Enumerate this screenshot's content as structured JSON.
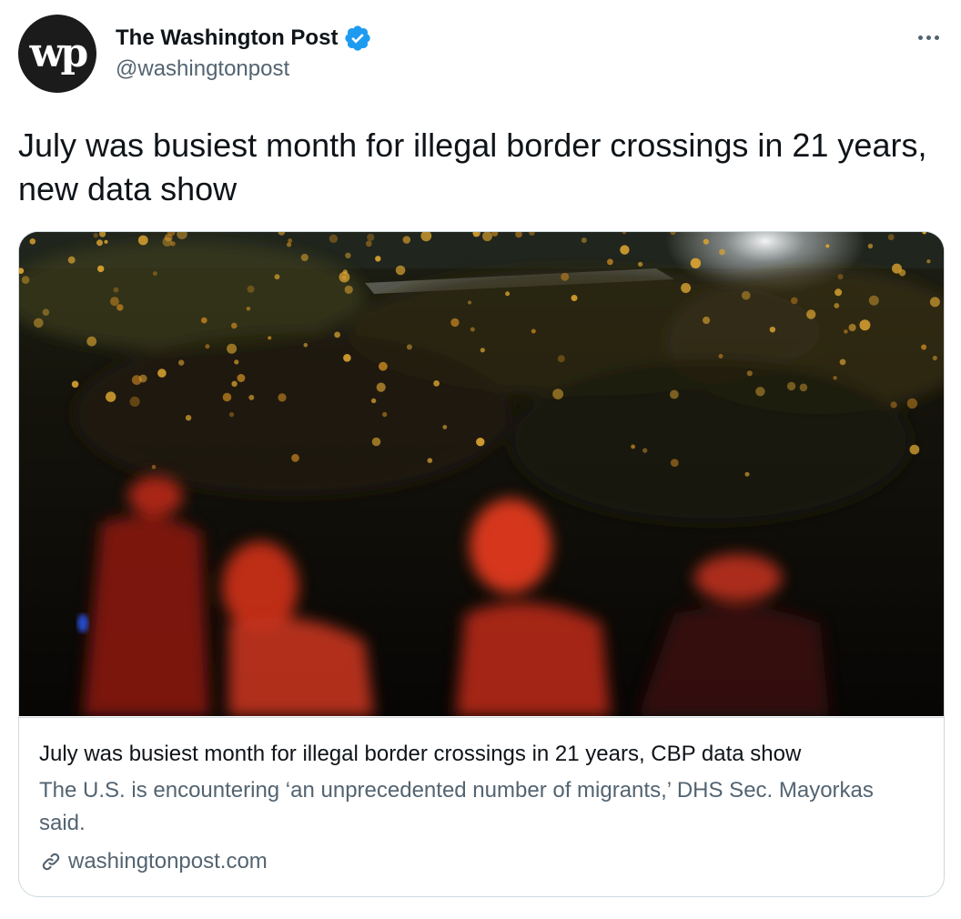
{
  "author": {
    "name": "The Washington Post",
    "handle": "@washingtonpost",
    "avatar_monogram": "wp",
    "verified_icon": "verified-badge-icon"
  },
  "more_icon": "more-options-icon",
  "tweet": {
    "text": "July was busiest month for illegal border crossings in 21 years, new data show"
  },
  "card": {
    "image_description": "",
    "title": "July was busiest month for illegal border crossings in 21 years, CBP data show",
    "description": "The U.S. is encountering ‘an unprecedented number of migrants,’ DHS Sec. Mayorkas said.",
    "domain": "washingtonpost.com",
    "link_icon": "link-icon"
  },
  "colors": {
    "text_primary": "#0f1419",
    "text_secondary": "#536471",
    "verified_blue": "#1d9bf0",
    "border": "#cfd9de"
  }
}
